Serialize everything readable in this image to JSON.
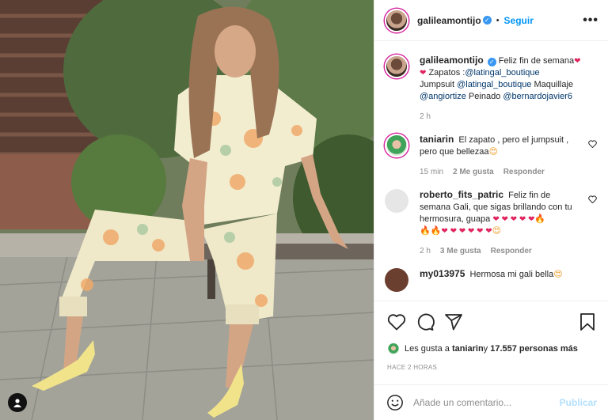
{
  "post_author": {
    "username": "galileamontijo",
    "follow_label": "Seguir",
    "more": "•••"
  },
  "caption": {
    "username": "galileamontijo",
    "text_1": "Feliz fin de semana",
    "text_2": "Zapatos :",
    "mention_1": "@latingal_boutique",
    "text_3": "Jumpsuit ",
    "mention_2": "@latingal_boutique",
    "text_4": " Maquillaje ",
    "mention_3": "@angiortize",
    "text_5": " Peinado ",
    "mention_4": "@bernardojavier6",
    "time": "2 h"
  },
  "comments": [
    {
      "username": "taniarin",
      "text": "El zapato , pero el jumpsuit , pero que bellezaa",
      "time": "15 min",
      "likes": "2 Me gusta",
      "reply": "Responder"
    },
    {
      "username": "roberto_fits_patric",
      "text": "Feliz fin de semana Gali, que sigas brillando con tu hermosura, guapa",
      "time": "2 h",
      "likes": "3 Me gusta",
      "reply": "Responder"
    },
    {
      "username": "my013975",
      "text": "Hermosa mi gali bella"
    }
  ],
  "likes": {
    "prefix": "Les gusta a ",
    "user": "taniarin",
    "middle": " y ",
    "count": "17.557 personas más"
  },
  "timestamp": "HACE 2 HORAS",
  "add_comment": {
    "placeholder": "Añade un comentario...",
    "publish": "Publicar"
  },
  "icons": [
    "heart-icon",
    "comment-icon",
    "share-icon",
    "bookmark-icon",
    "emoji-icon",
    "tag-user-icon",
    "verified-icon"
  ]
}
